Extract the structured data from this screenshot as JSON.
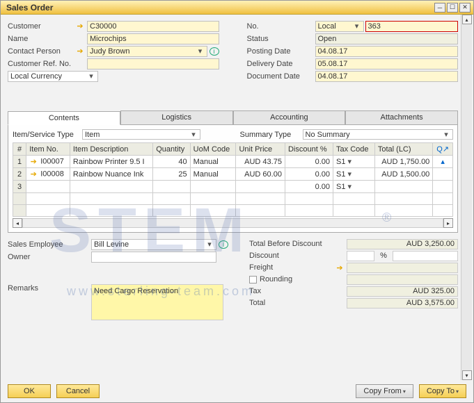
{
  "window": {
    "title": "Sales Order"
  },
  "left": {
    "customer_label": "Customer",
    "customer": "C30000",
    "name_label": "Name",
    "name": "Microchips",
    "contact_label": "Contact Person",
    "contact": "Judy Brown",
    "cref_label": "Customer Ref. No.",
    "cref": "",
    "currency": "Local Currency"
  },
  "right": {
    "no_label": "No.",
    "no_type": "Local",
    "no_value": "363",
    "status_label": "Status",
    "status": "Open",
    "posting_label": "Posting Date",
    "posting": "04.08.17",
    "delivery_label": "Delivery Date",
    "delivery": "05.08.17",
    "docdate_label": "Document Date",
    "docdate": "04.08.17"
  },
  "tabs": {
    "contents": "Contents",
    "logistics": "Logistics",
    "accounting": "Accounting",
    "attachments": "Attachments"
  },
  "grid": {
    "itemservice_label": "Item/Service Type",
    "itemservice": "Item",
    "summary_label": "Summary Type",
    "summary": "No Summary",
    "headers": {
      "num": "#",
      "itemno": "Item No.",
      "desc": "Item Description",
      "qty": "Quantity",
      "uom": "UoM Code",
      "price": "Unit Price",
      "disc": "Discount %",
      "tax": "Tax Code",
      "total": "Total (LC)",
      "q": "Q"
    },
    "rows": [
      {
        "n": "1",
        "itemno": "I00007",
        "desc": "Rainbow Printer 9.5 I",
        "qty": "40",
        "uom": "Manual",
        "price": "AUD 43.75",
        "disc": "0.00",
        "tax": "S1",
        "total": "AUD 1,750.00"
      },
      {
        "n": "2",
        "itemno": "I00008",
        "desc": "Rainbow Nuance Ink",
        "qty": "25",
        "uom": "Manual",
        "price": "AUD 60.00",
        "disc": "0.00",
        "tax": "S1",
        "total": "AUD 1,500.00"
      },
      {
        "n": "3",
        "itemno": "",
        "desc": "",
        "qty": "",
        "uom": "",
        "price": "",
        "disc": "0.00",
        "tax": "S1",
        "total": ""
      }
    ]
  },
  "salesemp_label": "Sales Employee",
  "salesemp": "Bill Levine",
  "owner_label": "Owner",
  "owner": "",
  "totals": {
    "tbd_label": "Total Before Discount",
    "tbd": "AUD 3,250.00",
    "disc_label": "Discount",
    "disc_pct": "",
    "disc_val": "",
    "freight_label": "Freight",
    "freight": "",
    "rounding_label": "Rounding",
    "rounding": "",
    "tax_label": "Tax",
    "tax": "AUD 325.00",
    "total_label": "Total",
    "total": "AUD 3,575.00"
  },
  "remarks_label": "Remarks",
  "remarks": "Need Cargo Reservation",
  "buttons": {
    "ok": "OK",
    "cancel": "Cancel",
    "copyfrom": "Copy From",
    "copyto": "Copy To"
  },
  "watermark": {
    "big": "STEM",
    "url": "www.sterling-team.com",
    "reg": "®"
  }
}
